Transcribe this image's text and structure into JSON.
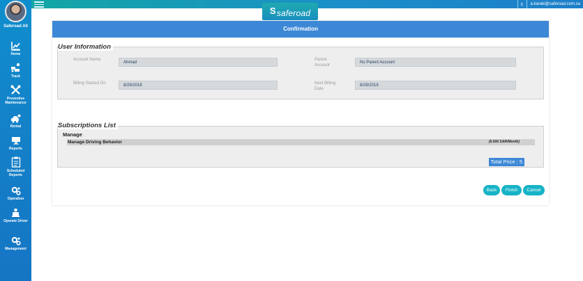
{
  "app": {
    "logo_text": "saferoad",
    "logo_mark": "S"
  },
  "topbar": {
    "lang_icon": "ع",
    "user_email": "a.karaki@saferoad.com.sa"
  },
  "sidebar": {
    "user_name": "Saferoad All",
    "items": [
      {
        "label": "Home",
        "icon": "chart-icon"
      },
      {
        "label": "Track",
        "icon": "track-icon"
      },
      {
        "label": "Preventive Maintenance",
        "icon": "tools-icon"
      },
      {
        "label": "Rental",
        "icon": "car-icon"
      },
      {
        "label": "Reports",
        "icon": "board-icon"
      },
      {
        "label": "Scheduled Reports",
        "icon": "schedule-icon"
      },
      {
        "label": "Operation",
        "icon": "gears-icon"
      },
      {
        "label": "Operate Driver",
        "icon": "driver-icon"
      },
      {
        "label": "Management",
        "icon": "gears-icon"
      }
    ]
  },
  "panel": {
    "title": "Confirmation",
    "user_info": {
      "title": "User Information",
      "account_name_label": "Account Name",
      "account_name": "Ahmad",
      "parent_account_label": "Parent Account",
      "parent_account": "No Parent Account",
      "billing_started_label": "Billing Started On",
      "billing_started": "8/29/2018",
      "next_billing_label": "Next Billing Date",
      "next_billing": "8/29/2019"
    },
    "subscriptions": {
      "title": "Subscriptions List",
      "group": "Manage",
      "item_name": "Manage Driving Behavior",
      "item_price": "(5.000 SAR/Month)",
      "total": "Total Price : 5"
    },
    "buttons": {
      "back": "Back",
      "finish": "Finish",
      "cancel": "Cancel"
    }
  }
}
